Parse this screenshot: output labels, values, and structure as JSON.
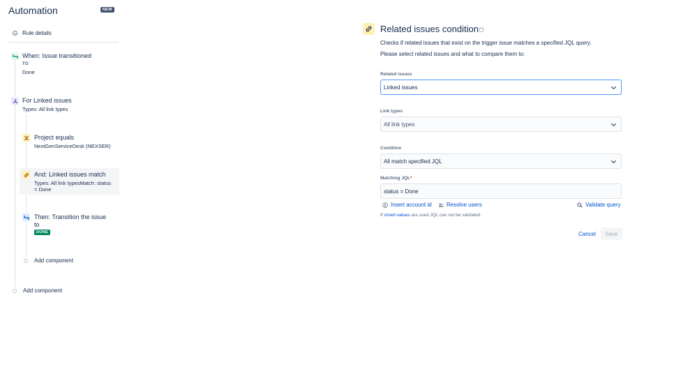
{
  "app": {
    "title": "Automation",
    "badge": "NEW"
  },
  "sidebar": {
    "rule_details": "Rule details",
    "trigger": {
      "title": "When: Issue transitioned",
      "caption": "TO",
      "value": "Done"
    },
    "branch": {
      "title": "For Linked issues",
      "sub": "Types: All link types"
    },
    "condition1": {
      "title": "Project equals",
      "sub": "NextGenServiceDesk (NEXSER)"
    },
    "condition2": {
      "title": "And: Linked issues match",
      "sub_line1": "Types: All link typesMatch: status",
      "sub_line2": "= Done"
    },
    "action": {
      "title_line1": "Then: Transition the issue",
      "title_line2": "to",
      "lozenge": "DONE"
    },
    "add_inner": "Add component",
    "add_outer": "Add component"
  },
  "panel": {
    "title": "Related issues condition",
    "description1": "Checks if related issues that exist on the trigger issue matches a specified JQL query.",
    "description2": "Please select related issues and what to compare them to:",
    "related_issues": {
      "label": "Related issues",
      "value": "Linked issues"
    },
    "link_types": {
      "label": "Link types",
      "value": "All link types"
    },
    "condition": {
      "label": "Condition",
      "value": "All match specified JQL"
    },
    "matching_jql": {
      "label": "Matching JQL",
      "required_mark": "*",
      "value": "status = Done"
    },
    "insert_account_id": "Insert account id",
    "resolve_users": "Resolve users",
    "validate_query": "Validate query",
    "hint": {
      "prefix": "If ",
      "link": "smart-values",
      "suffix": " are used JQL can not be validated."
    },
    "cancel": "Cancel",
    "save": "Save"
  },
  "colors": {
    "accent": "#0052cc",
    "focus": "#4c9aff",
    "done_green": "#00875a",
    "condition_yellow": "#fff0b3"
  }
}
